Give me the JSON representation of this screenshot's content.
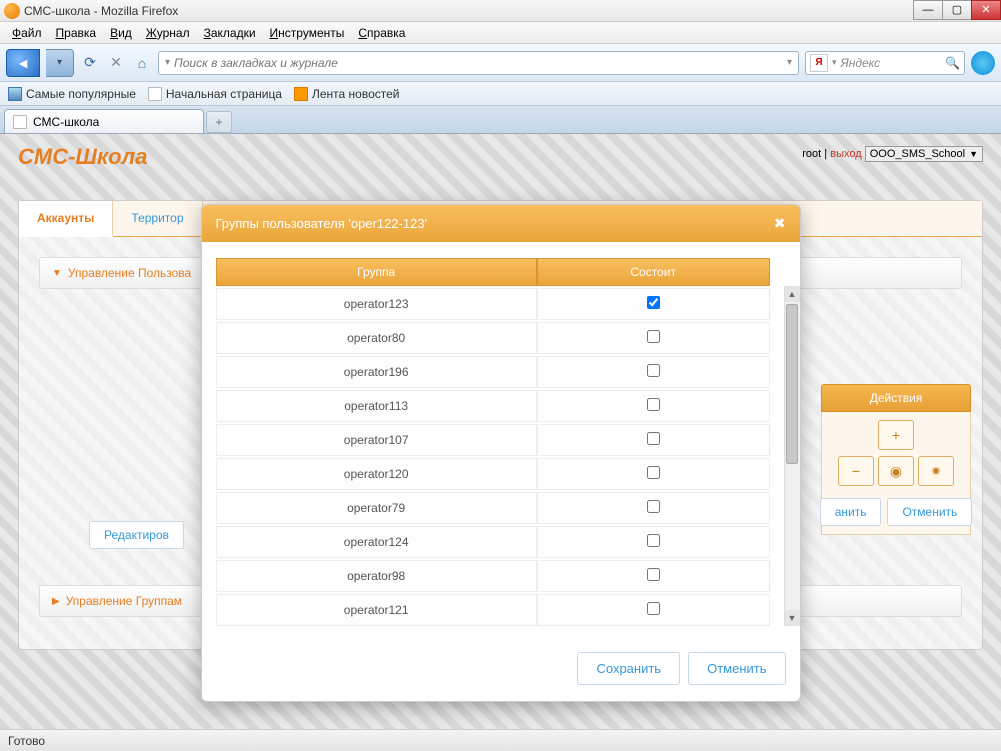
{
  "window": {
    "title": "СМС-школа - Mozilla Firefox"
  },
  "menu": {
    "file": "Файл",
    "edit": "Правка",
    "view": "Вид",
    "history": "Журнал",
    "bookmarks": "Закладки",
    "tools": "Инструменты",
    "help": "Справка"
  },
  "nav": {
    "search_placeholder": "Поиск в закладках и журнале",
    "yandex": "Яндекс"
  },
  "bookmarks": {
    "popular": "Самые популярные",
    "start": "Начальная страница",
    "news": "Лента новостей"
  },
  "tab": {
    "label": "СМС-школа"
  },
  "app": {
    "title": "СМС-Школа",
    "user": "root",
    "logout": "выход",
    "school": "OOO_SMS_School"
  },
  "page_tabs": {
    "accounts": "Аккаунты",
    "territory": "Территор"
  },
  "accordion": {
    "users": "Управление Пользова",
    "groups": "Управление Группам"
  },
  "actions": {
    "header": "Действия",
    "save": "анить",
    "cancel": "Отменить"
  },
  "edit_btn": "Редактиров",
  "modal": {
    "title": "Группы пользователя 'oper122-123'",
    "col_group": "Группа",
    "col_member": "Состоит",
    "save": "Сохранить",
    "cancel": "Отменить",
    "rows": [
      {
        "name": "operator123",
        "checked": true
      },
      {
        "name": "operator80",
        "checked": false
      },
      {
        "name": "operator196",
        "checked": false
      },
      {
        "name": "operator113",
        "checked": false
      },
      {
        "name": "operator107",
        "checked": false
      },
      {
        "name": "operator120",
        "checked": false
      },
      {
        "name": "operator79",
        "checked": false
      },
      {
        "name": "operator124",
        "checked": false
      },
      {
        "name": "operator98",
        "checked": false
      },
      {
        "name": "operator121",
        "checked": false
      }
    ]
  },
  "status": "Готово"
}
